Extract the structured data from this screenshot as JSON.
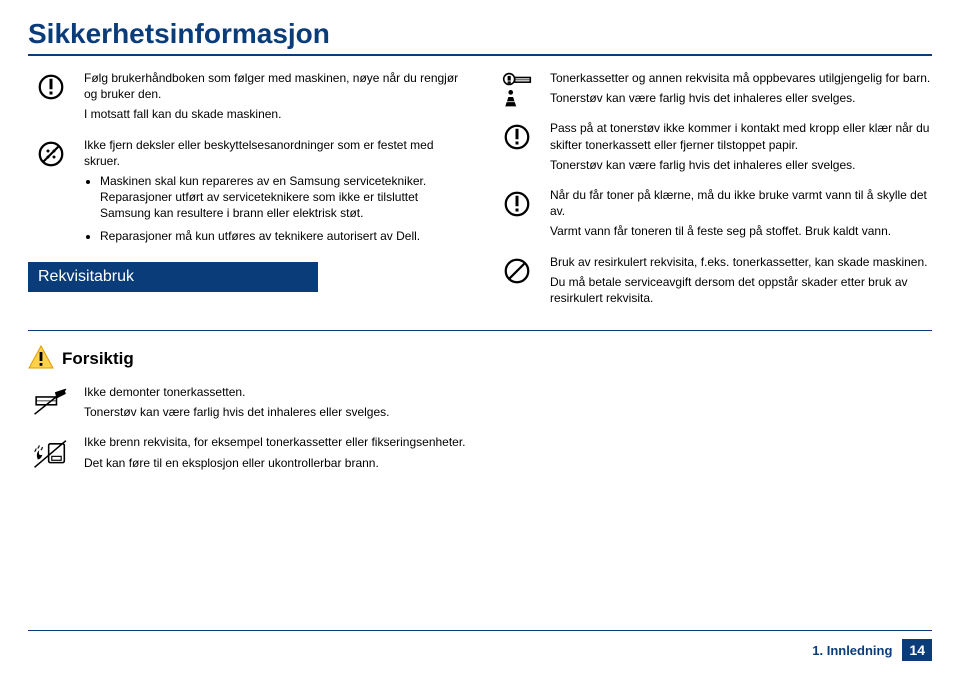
{
  "title": "Sikkerhetsinformasjon",
  "left": {
    "r1a": "Følg brukerhåndboken som følger med maskinen, nøye når du rengjør og bruker den.",
    "r1b": "I motsatt fall kan du skade maskinen.",
    "r2_intro": "Ikke fjern deksler eller beskyttelsesanordninger som er festet med skruer.",
    "r2_li1": "Maskinen skal kun repareres av en Samsung servicetekniker. Reparasjoner utført av serviceteknikere som ikke er tilsluttet Samsung kan resultere i brann eller elektrisk støt.",
    "r2_li2": "Reparasjoner må kun utføres av teknikere autorisert av Dell."
  },
  "sectionBar": "Rekvisitabruk",
  "right": {
    "r1a": "Tonerkassetter og annen rekvisita må oppbevares utilgjengelig for barn.",
    "r1b": "Tonerstøv kan være farlig hvis det inhaleres eller svelges.",
    "r2a": "Pass på at tonerstøv ikke kommer i kontakt med kropp eller klær når du skifter tonerkassett eller fjerner tilstoppet papir.",
    "r2b": "Tonerstøv kan være farlig hvis det inhaleres eller svelges.",
    "r3a": "Når du får toner på klærne, må du ikke bruke varmt vann til å skylle det av.",
    "r3b": "Varmt vann får toneren til å feste seg på stoffet. Bruk kaldt vann.",
    "r4a": "Bruk av resirkulert rekvisita, f.eks. tonerkassetter, kan skade maskinen.",
    "r4b": "Du må betale serviceavgift dersom det oppstår skader etter bruk av resirkulert rekvisita."
  },
  "caution": "Forsiktig",
  "bottom": {
    "b1a": "Ikke demonter tonerkassetten.",
    "b1b": "Tonerstøv kan være farlig hvis det inhaleres eller svelges.",
    "b2a": "Ikke brenn rekvisita, for eksempel tonerkassetter eller fikseringsenheter.",
    "b2b": "Det kan føre til en eksplosjon eller ukontrollerbar brann."
  },
  "footer": {
    "chapter": "1. Innledning",
    "page": "14"
  }
}
